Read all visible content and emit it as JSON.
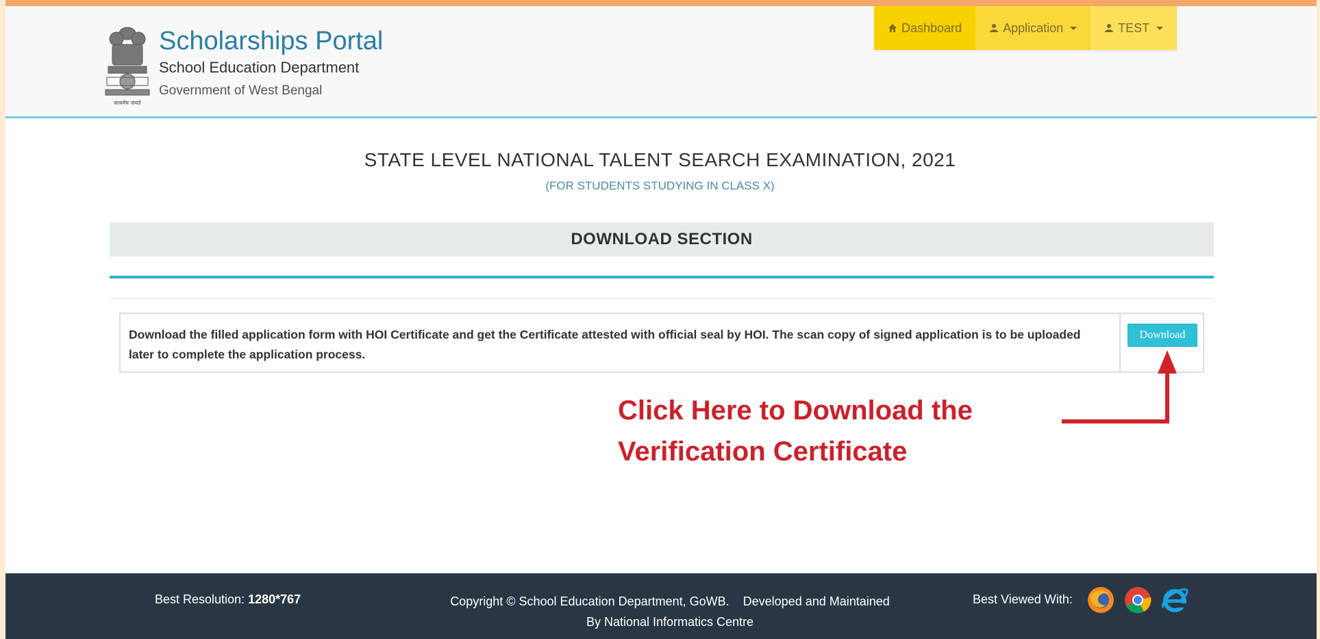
{
  "header": {
    "title": "Scholarships Portal",
    "department": "School Education Department",
    "government": "Government of West Bengal"
  },
  "nav": {
    "dashboard": "Dashboard",
    "application": "Application",
    "user": "TEST"
  },
  "exam": {
    "title": "STATE LEVEL NATIONAL TALENT SEARCH EXAMINATION, 2021",
    "subtitle": "(FOR STUDENTS STUDYING IN CLASS X)"
  },
  "section": {
    "title": "DOWNLOAD SECTION",
    "description": "Download the filled application form with HOI Certificate and get the Certificate attested with official seal by HOI. The scan copy of signed application is to be uploaded later to complete the application process.",
    "button_label": "Download"
  },
  "annotation": {
    "line1": "Click Here to Download the",
    "line2": "Verification Certificate",
    "color": "#c9222b"
  },
  "footer": {
    "best_resolution_label": "Best Resolution:",
    "best_resolution_value": "1280*767",
    "copyright_line1": "Copyright © School Education Department, GoWB.    Developed and Maintained",
    "copyright_line2": "By National Informatics Centre",
    "best_viewed_label": "Best Viewed With:",
    "browsers": [
      "firefox-icon",
      "chrome-icon",
      "internet-explorer-icon"
    ]
  },
  "colors": {
    "accent": "#2fb1cd",
    "nav": "#f8d500",
    "footer": "#293744",
    "brand": "#2b7ea3"
  }
}
